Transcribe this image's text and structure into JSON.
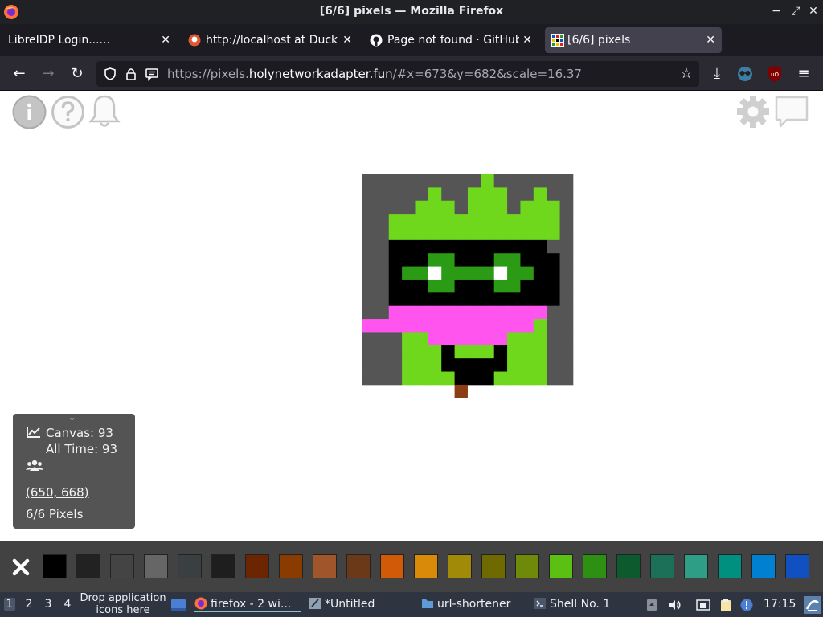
{
  "window": {
    "title": "[6/6] pixels — Mozilla Firefox",
    "controls": {
      "minimize": "−",
      "restore": "⤢",
      "close": "✕"
    }
  },
  "tabs": [
    {
      "label": "LibreIDP Login......",
      "icon": "none",
      "active": false
    },
    {
      "label": "http://localhost at Duck",
      "icon": "duckduckgo-icon",
      "active": false
    },
    {
      "label": "Page not found · GitHub",
      "icon": "github-icon",
      "active": false
    },
    {
      "label": "[6/6] pixels",
      "icon": "pixels-favicon",
      "active": true
    }
  ],
  "navbar": {
    "url_prefix": "https://pixels.",
    "url_domain": "holynetworkadapter.fun",
    "url_suffix": "/#x=673&y=682&scale=16.37"
  },
  "page": {
    "stats": {
      "canvas_label": "Canvas: 93",
      "alltime_label": "All Time: 93",
      "coords": "(650, 668)",
      "pixels": "6/6 Pixels"
    },
    "pixel_art": {
      "colors": {
        "G": "#555555",
        "L": "#6fd81c",
        "B": "#000000",
        "D": "#2b9b15",
        "W": "#ffffff",
        "P": "#ff55ee",
        "N": "#8b3e15",
        "X": "#ffffff"
      }
    },
    "palette_colors": [
      "#000000",
      "#222222",
      "#444444",
      "#666666",
      "#3a3f42",
      "#1e1e1e",
      "#6b2500",
      "#8a3c00",
      "#a0552a",
      "#6b3818",
      "#d05a08",
      "#d88a08",
      "#a08a08",
      "#6e6a00",
      "#6e8a08",
      "#5cc012",
      "#2e9012",
      "#0d5a2e",
      "#1c7058",
      "#2e9e86",
      "#009080",
      "#0080d0",
      "#1050c0"
    ]
  },
  "taskbar": {
    "workspaces": [
      "1",
      "2",
      "3",
      "4"
    ],
    "drop_text": "Drop application icons here",
    "items": [
      {
        "label": "firefox - 2 wi...",
        "icon": "firefox-icon",
        "active": true
      },
      {
        "label": "*Untitled",
        "icon": "text-editor-icon",
        "active": false
      },
      {
        "label": "url-shortener",
        "icon": "folder-icon",
        "active": false
      },
      {
        "label": "Shell No. 1",
        "icon": "terminal-icon",
        "active": false
      }
    ],
    "clock": "17:15"
  }
}
